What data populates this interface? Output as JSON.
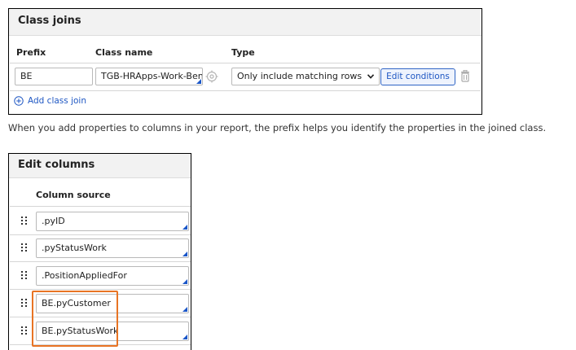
{
  "class_joins": {
    "title": "Class joins",
    "headers": {
      "prefix": "Prefix",
      "class_name": "Class name",
      "type": "Type"
    },
    "row": {
      "prefix": "BE",
      "class_name": "TGB-HRApps-Work-Bene",
      "type": "Only include matching rows",
      "edit_conditions": "Edit conditions"
    },
    "add_label": "Add class join"
  },
  "description": "When you add properties to columns in your report, the prefix helps you identify the properties in the joined class.",
  "edit_columns": {
    "title": "Edit columns",
    "header": "Column source",
    "rows": [
      {
        "value": ".pyID"
      },
      {
        "value": ".pyStatusWork"
      },
      {
        "value": ".PositionAppliedFor"
      },
      {
        "value": "BE.pyCustomer"
      },
      {
        "value": "BE.pyStatusWork"
      }
    ]
  },
  "colors": {
    "accent": "#1f57c3",
    "highlight": "#e87424",
    "panel_header": "#f2f2f2"
  }
}
